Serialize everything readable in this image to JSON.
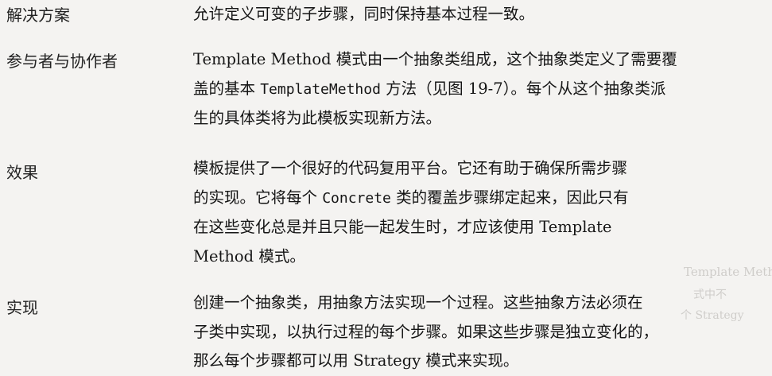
{
  "rows": [
    {
      "label": "解决方案",
      "lines": [
        {
          "text": "允许定义可变的子步骤，同时保持基本过程一致。"
        }
      ]
    },
    {
      "label": "参与者与协作者",
      "lines": [
        {
          "p1": "Template Method 模式由一个抽象类组成，这个抽象类定义了需要覆"
        },
        {
          "p1": "盖的基本 ",
          "mono": "TemplateMethod",
          "p2": " 方法（见图 19-7）。每个从这个抽象类派"
        },
        {
          "p1": "生的具体类将为此模板实现新方法。"
        }
      ]
    },
    {
      "label": "效果",
      "lines": [
        {
          "p1": "模板提供了一个很好的代码复用平台。它还有助于确保所需步骤"
        },
        {
          "p1": "的实现。它将每个 ",
          "mono": "Concrete",
          "p2": " 类的覆盖步骤绑定起来，因此只有"
        },
        {
          "p1": "在这些变化总是并且只能一起发生时，才应该使用 Template"
        },
        {
          "p1": "Method 模式。"
        }
      ]
    },
    {
      "label": "实现",
      "lines": [
        {
          "p1": "创建一个抽象类，用抽象方法实现一个过程。这些抽象方法必须在"
        },
        {
          "p1": "子类中实现，以执行过程的每个步骤。如果这些步骤是独立变化的，"
        },
        {
          "p1": "那么每个步骤都可以用 Strategy 模式来实现。"
        }
      ]
    }
  ],
  "bleed": {
    "right_top_1": "Template Metho",
    "right_top_2": "式中不",
    "right_top_3": "个 Strategy"
  }
}
